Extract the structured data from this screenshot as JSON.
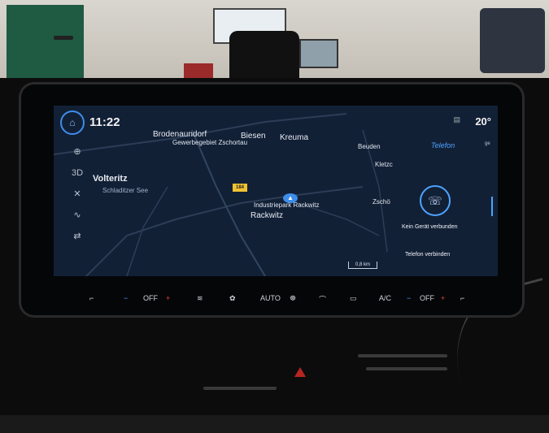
{
  "status_bar": {
    "time": "11:22",
    "temperature": "20°"
  },
  "sidebar": {
    "items": [
      {
        "icon": "navigation-icon",
        "glyph": "⊕"
      },
      {
        "icon": "3d-view-icon",
        "glyph": "3D"
      },
      {
        "icon": "expand-icon",
        "glyph": "✕"
      },
      {
        "icon": "route-icon",
        "glyph": "∿"
      },
      {
        "icon": "swap-icon",
        "glyph": "⇄"
      }
    ]
  },
  "map": {
    "labels": {
      "brodenaundorf": "Brodenaundorf",
      "gewerbegebiet": "Gewerbegebiet Zschortau",
      "biesen": "Biesen",
      "kreuma": "Kreuma",
      "beuden": "Beuden",
      "kletz": "Kletzc",
      "wolteritz": "Volteritz",
      "schladitzer": "Schladitzer See",
      "industriepark": "Industriepark Rackwitz",
      "rackwitz": "Rackwitz",
      "zsch": "Zschö"
    },
    "road_number": "184",
    "scale": "0,8 km"
  },
  "phone": {
    "tab": "Telefon",
    "status": "Kein Gerät verbunden",
    "connect": "Telefon verbinden"
  },
  "climate": {
    "left_off": "OFF",
    "auto": "AUTO",
    "ac": "A/C",
    "right_off": "OFF",
    "minus": "−",
    "plus": "+"
  }
}
